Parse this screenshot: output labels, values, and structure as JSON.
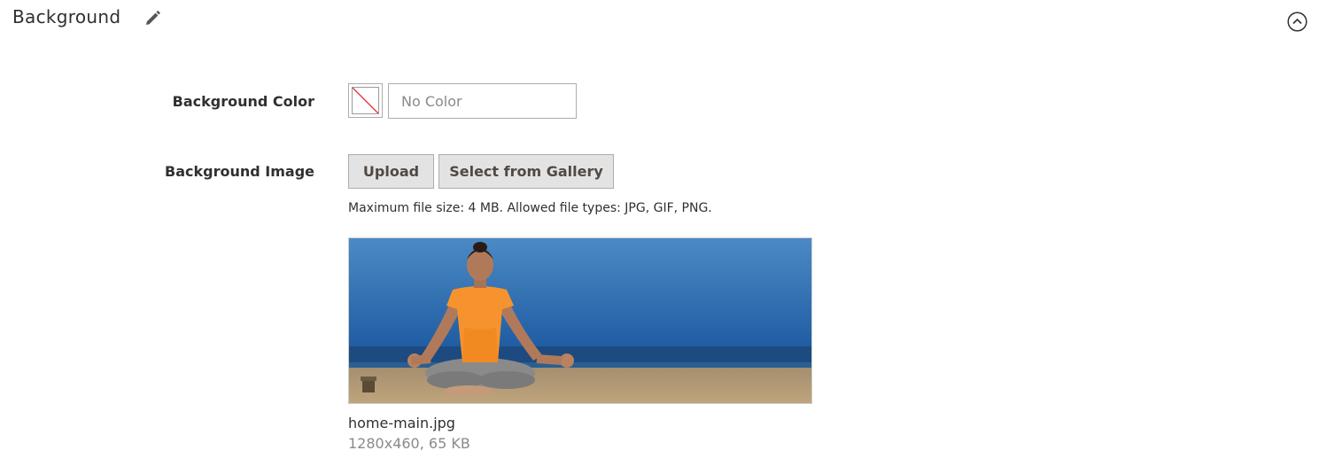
{
  "section": {
    "title": "Background",
    "edit_icon": "pencil-icon",
    "collapse_icon": "chevron-up-circle-icon"
  },
  "fields": {
    "color": {
      "label": "Background Color",
      "placeholder": "No Color",
      "value": "",
      "swatch_icon": "no-color-swatch-icon"
    },
    "image": {
      "label": "Background Image",
      "upload_label": "Upload",
      "gallery_label": "Select from Gallery",
      "note": "Maximum file size: 4 MB. Allowed file types: JPG, GIF, PNG.",
      "file_name": "home-main.jpg",
      "file_meta": "1280x460, 65 KB"
    }
  },
  "colors": {
    "sky": "#2f74b5",
    "sea": "#1e4e86",
    "sand": "#b69a73",
    "shirt": "#f7932e",
    "button_bg": "#e3e3e3",
    "border": "#adadad",
    "swatch_slash": "#e22626"
  }
}
